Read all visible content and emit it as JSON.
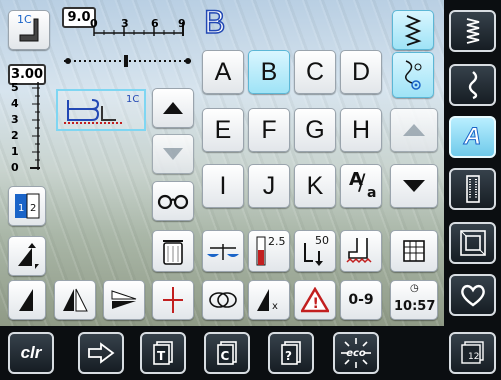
{
  "presser_foot": {
    "number": "1C"
  },
  "stitch_width": {
    "value": "9.0",
    "ticks": [
      "0",
      "3",
      "6",
      "9"
    ]
  },
  "stitch_length": {
    "value": "3.00",
    "ticks": [
      "5",
      "4",
      "3",
      "2",
      "1",
      "0"
    ]
  },
  "preview": {
    "foot_number": "1C"
  },
  "letters": {
    "row1": [
      "A",
      "B",
      "C",
      "D"
    ],
    "row2": [
      "E",
      "F",
      "G",
      "H"
    ],
    "row3": [
      "I",
      "J",
      "K"
    ],
    "selected": "B"
  },
  "uppercase_lowercase": {
    "upper": "A",
    "lower": "a"
  },
  "upper_thread_tension": {
    "value": "2.5"
  },
  "presser_foot_pressure": {
    "value": "50"
  },
  "numbers_button": {
    "label": "0-9"
  },
  "clock": {
    "time": "10:57"
  },
  "bottom_bar": {
    "clr_label": "clr",
    "eco_label": "eco"
  },
  "right_bar": {
    "personal_program_label": "12"
  },
  "accent_color": "#7fd6f2"
}
